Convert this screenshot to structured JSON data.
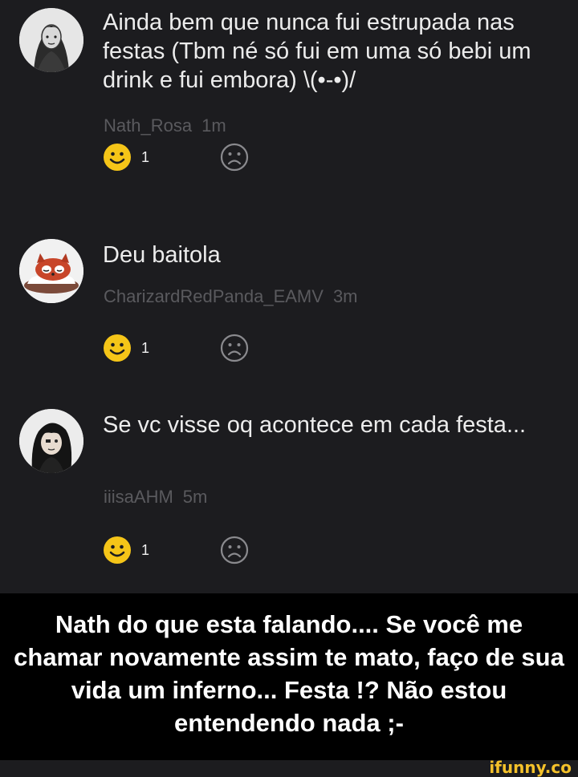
{
  "comments": [
    {
      "text": "Ainda bem que nunca fui estrupada nas festas (Tbm né só fui em uma só bebi um drink e fui embora) \\(•-•)/",
      "username": "Nath_Rosa",
      "time": "1m",
      "happy_count": "1",
      "avatar_icon": "girl-portrait-avatar"
    },
    {
      "text": "Deu baitola",
      "username": "CharizardRedPanda_EAMV",
      "time": "3m",
      "happy_count": "1",
      "avatar_icon": "red-panda-avatar"
    },
    {
      "text": "Se vc visse oq acontece em cada festa...",
      "username": "iiisaAHM",
      "time": "5m",
      "happy_count": "1",
      "avatar_icon": "anime-character-avatar"
    }
  ],
  "caption": "Nath do que esta falando.... Se você me chamar novamente assim te mato, faço de sua vida um inferno... Festa !? Não estou entendendo nada ;-",
  "watermark": "ifunny.co",
  "colors": {
    "background": "#1c1c1f",
    "text": "#ececec",
    "meta": "#5a5a5e",
    "happy_face": "#f5c518",
    "sad_face": "#8a8a8e",
    "caption_bg": "#000000",
    "watermark": "#f4c12a"
  }
}
